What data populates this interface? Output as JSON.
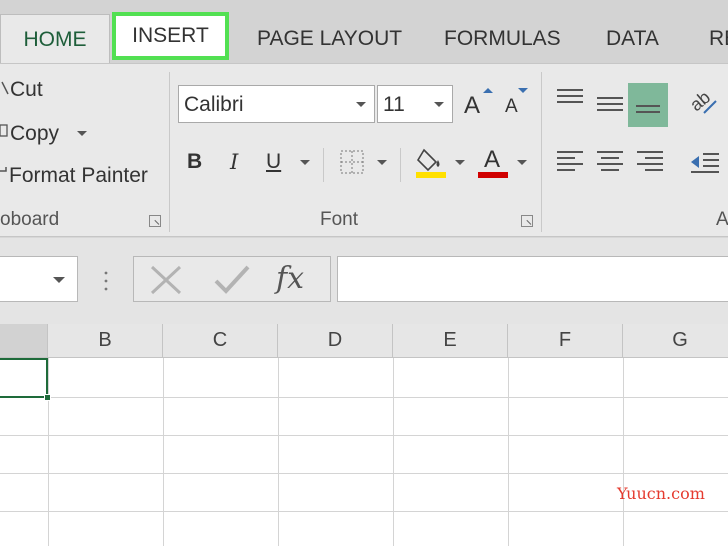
{
  "tabs": [
    "HOME",
    "INSERT",
    "PAGE LAYOUT",
    "FORMULAS",
    "DATA",
    "RE"
  ],
  "clipboard": {
    "cut": "Cut",
    "copy": "Copy",
    "format_painter": "Format Painter",
    "group_label": "oboard"
  },
  "font": {
    "font_name": "Calibri",
    "font_size": "11",
    "bold": "B",
    "italic": "I",
    "underline": "U",
    "group_label": "Font",
    "increase_size": "A",
    "decrease_size": "A",
    "font_color_letter": "A"
  },
  "alignment": {
    "group_label": "A"
  },
  "formula_bar": {
    "fx": "fx",
    "name_box": "",
    "formula": ""
  },
  "columns": [
    "B",
    "C",
    "D",
    "E",
    "F",
    "G"
  ],
  "watermark": "Yuucn.com",
  "colors": {
    "highlight_tab_border": "#52e052",
    "fill_color": "#ffe000",
    "font_color": "#d00000",
    "selected_cell": "#1e6b3a",
    "active_align": "#7fb89a"
  }
}
